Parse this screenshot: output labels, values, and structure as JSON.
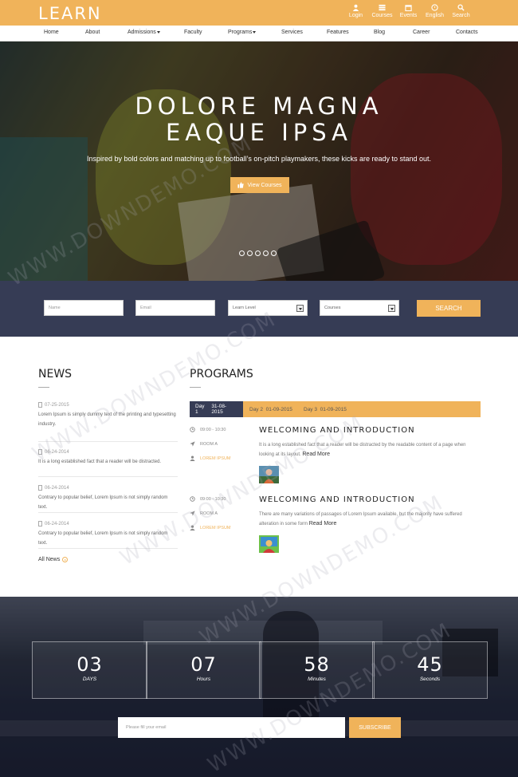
{
  "brand": {
    "logo": "LEARN"
  },
  "top_links": [
    {
      "label": "Login",
      "icon": "user-icon"
    },
    {
      "label": "Courses",
      "icon": "list-icon"
    },
    {
      "label": "Events",
      "icon": "calendar-icon"
    },
    {
      "label": "English",
      "icon": "globe-icon"
    },
    {
      "label": "Search",
      "icon": "search-icon"
    }
  ],
  "nav": [
    {
      "label": "Home"
    },
    {
      "label": "About"
    },
    {
      "label": "Admissions"
    },
    {
      "label": "Faculty"
    },
    {
      "label": "Programs"
    },
    {
      "label": "Services"
    },
    {
      "label": "Features"
    },
    {
      "label": "Blog"
    },
    {
      "label": "Career"
    },
    {
      "label": "Contacts"
    }
  ],
  "hero": {
    "title_line1": "DOLORE MAGNA",
    "title_line2": "EAQUE IPSA",
    "subtitle": "Inspired by bold colors and matching up to football’s on-pitch playmakers, these kicks are ready to stand out.",
    "button": "View Courses",
    "slide_count": 5
  },
  "search": {
    "name_placeholder": "Name",
    "email_placeholder": "Email",
    "level_value": "Learn Level",
    "courses_value": "Courses",
    "button": "SEARCH"
  },
  "news": {
    "title": "NEWS",
    "items": [
      {
        "date": "07-25-2015",
        "text": "Lorem Ipsum is simply dummy text of the printing and typesetting industry."
      },
      {
        "date": "06-24-2014",
        "text": "It is a long established fact that a reader will be distracted."
      },
      {
        "date": "06-24-2014",
        "text": "Contrary to popular belief, Lorem Ipsum is not simply random text."
      },
      {
        "date": "06-24-2014",
        "text": "Contrary to popular belief, Lorem Ipsum is not simply random text."
      }
    ],
    "all_link": "All News"
  },
  "programs": {
    "title": "PROGRAMS",
    "tabs": [
      {
        "day": "Day 1",
        "date": "31-08-2015"
      },
      {
        "day": "Day 2",
        "date": "01-09-2015"
      },
      {
        "day": "Day 3",
        "date": "01-09-2015"
      }
    ],
    "items": [
      {
        "time": "09:00 - 10:30",
        "room": "ROOM A",
        "speaker": "LOREM IPSUM",
        "title": "WELCOMING AND INTRODUCTION",
        "text": "It is a long established fact that a reader will be distracted by the readable content of a page when looking at its layout.",
        "more": "Read More"
      },
      {
        "time": "09:00 - 10:30",
        "room": "ROOM A",
        "speaker": "LOREM IPSUM",
        "title": "WELCOMING AND INTRODUCTION",
        "text": "There are many variations of passages of Lorem Ipsum available, but the majority have suffered alteration in some form",
        "more": "Read More"
      }
    ]
  },
  "countdown": [
    {
      "value": "03",
      "label": "DAYS"
    },
    {
      "value": "07",
      "label": "Hours"
    },
    {
      "value": "58",
      "label": "Minutes"
    },
    {
      "value": "45",
      "label": "Seconds"
    }
  ],
  "newsletter": {
    "placeholder": "Please fill your email",
    "button": "SUBSCRIBE"
  },
  "watermark": "WWW.DOWNDEMO.COM",
  "colors": {
    "accent": "#f0b35a",
    "navy": "#363c55"
  }
}
